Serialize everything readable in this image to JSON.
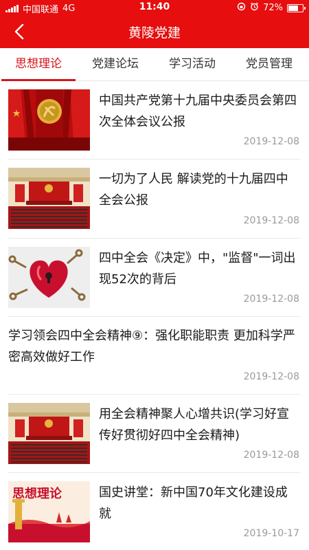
{
  "status_bar": {
    "carrier": "中国联通",
    "network": "4G",
    "time": "11:40",
    "battery": "72%",
    "battery_level": 0.72
  },
  "header": {
    "title": "黄陵党建",
    "back_icon": "chevron-left-icon"
  },
  "tabs": [
    {
      "label": "思想理论",
      "active": true
    },
    {
      "label": "党建论坛",
      "active": false
    },
    {
      "label": "学习活动",
      "active": false
    },
    {
      "label": "党员管理",
      "active": false
    }
  ],
  "articles": [
    {
      "title": "中国共产党第十九届中央委员会第四次全体会议公报",
      "date": "2019-12-08",
      "image": "party-emblem-flags"
    },
    {
      "title": "一切为了人民 解读党的十九届四中全会公报",
      "date": "2019-12-08",
      "image": "great-hall-session"
    },
    {
      "title": "四中全会《决定》中，\"监督\"一词出现52次的背后",
      "date": "2019-12-08",
      "image": "heart-lock-keys"
    },
    {
      "title": "学习领会四中全会精神⑨：强化职能职责 更加科学严密高效做好工作",
      "date": "2019-12-08",
      "image": ""
    },
    {
      "title": "用全会精神聚人心增共识(学习好宣传好贯彻好四中全会精神)",
      "date": "2019-12-08",
      "image": "great-hall-session"
    },
    {
      "title": "国史讲堂：新中国70年文化建设成就",
      "date": "2019-10-17",
      "image": "ideology-theory-banner",
      "image_text": "思想理论"
    }
  ],
  "colors": {
    "brand_red": "#e60e0e",
    "active_tab": "#d4141a",
    "date_gray": "#9a9a9a"
  }
}
